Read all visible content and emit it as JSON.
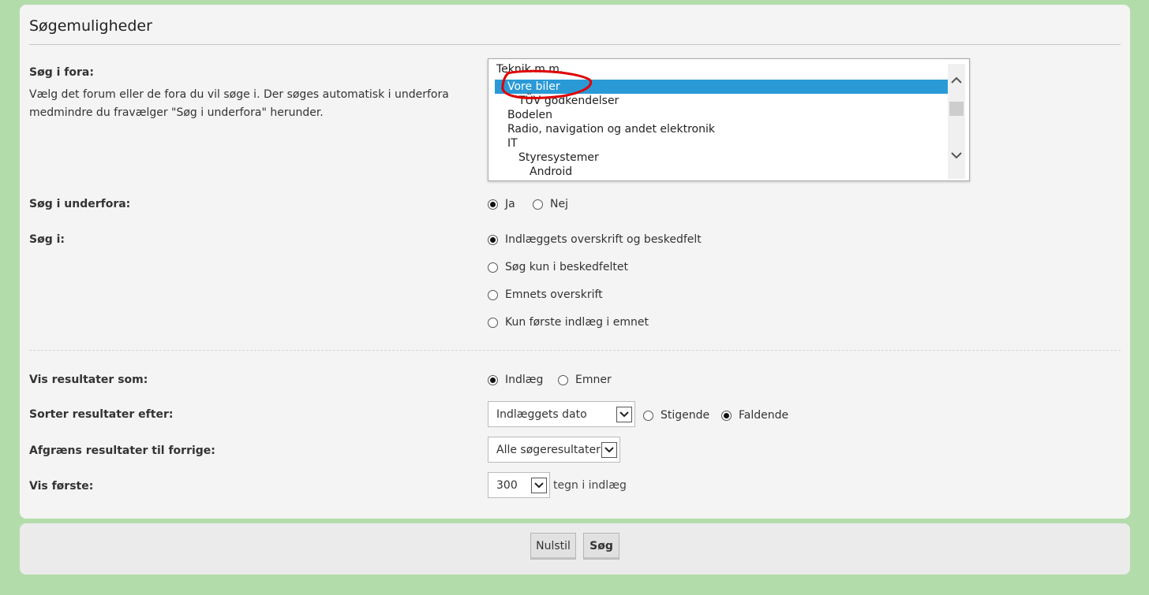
{
  "panel": {
    "title": "Søgemuligheder"
  },
  "forums": {
    "label": "Søg i fora:",
    "description": "Vælg det forum eller de fora du vil søge i. Der søges automatisk i underfora medmindre du fravælger \"Søg i underfora\" herunder.",
    "options": [
      {
        "label": "Teknik m.m.",
        "level": 0
      },
      {
        "label": "Vore biler",
        "level": 1,
        "selected": true
      },
      {
        "label": "TÜV godkendelser",
        "level": 2
      },
      {
        "label": "Bodelen",
        "level": 1
      },
      {
        "label": "Radio, navigation og andet elektronik",
        "level": 1
      },
      {
        "label": "IT",
        "level": 1
      },
      {
        "label": "Styresystemer",
        "level": 2
      },
      {
        "label": "Android",
        "level": 3
      }
    ]
  },
  "subforums": {
    "label": "Søg i underfora:",
    "yes": "Ja",
    "no": "Nej"
  },
  "search_in": {
    "label": "Søg i:",
    "options": [
      "Indlæggets overskrift og beskedfelt",
      "Søg kun i beskedfeltet",
      "Emnets overskrift",
      "Kun første indlæg i emnet"
    ]
  },
  "show_results": {
    "label": "Vis resultater som:",
    "posts": "Indlæg",
    "topics": "Emner"
  },
  "sort": {
    "label": "Sorter resultater efter:",
    "selected": "Indlæggets dato",
    "asc": "Stigende",
    "desc": "Faldende"
  },
  "limit": {
    "label": "Afgræns resultater til forrige:",
    "selected": "Alle søgeresultater"
  },
  "show_first": {
    "label": "Vis første:",
    "selected": "300",
    "suffix": "tegn i indlæg"
  },
  "buttons": {
    "reset": "Nulstil",
    "search": "Søg"
  },
  "colors": {
    "background": "#b3dcab",
    "selection": "#2a9ad6",
    "annotation": "#e00000"
  }
}
